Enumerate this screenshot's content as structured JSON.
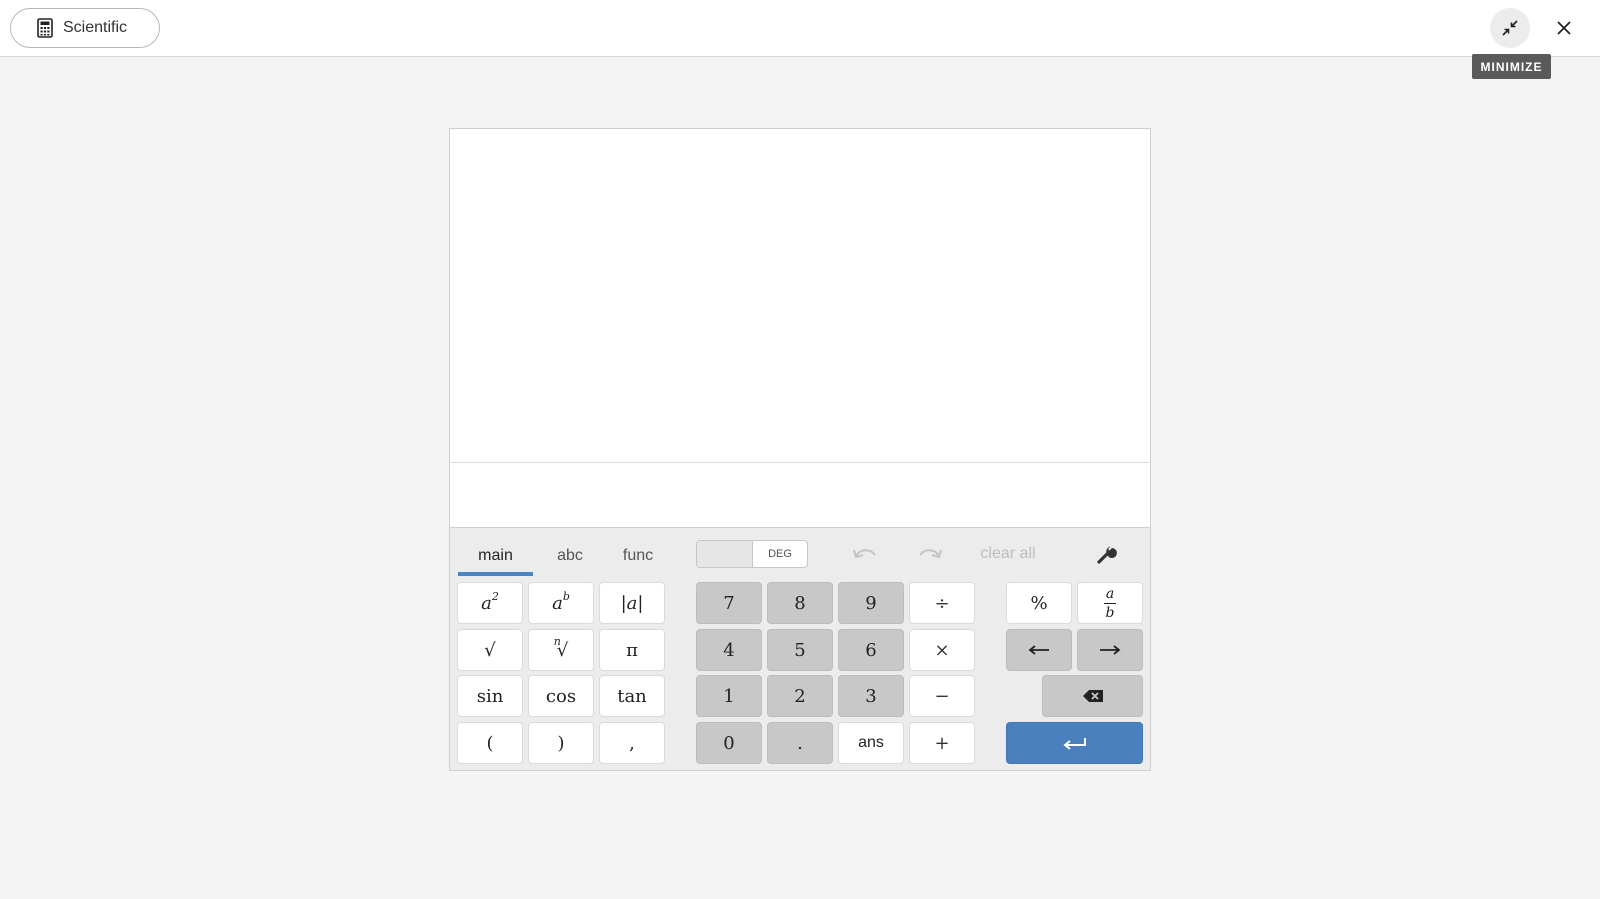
{
  "topbar": {
    "calculator_label": "Scientific",
    "tooltip": "MINIMIZE"
  },
  "keypad": {
    "tabs": [
      {
        "label": "main",
        "active": true
      },
      {
        "label": "abc",
        "active": false
      },
      {
        "label": "func",
        "active": false
      }
    ],
    "angle_mode": "DEG",
    "clear_all": "clear all",
    "functions": [
      [
        "a2",
        "ab",
        "|a|"
      ],
      [
        "√",
        "n√",
        "π"
      ],
      [
        "sin",
        "cos",
        "tan"
      ],
      [
        "(",
        ")",
        ","
      ]
    ],
    "numbers": [
      [
        "7",
        "8",
        "9",
        "÷"
      ],
      [
        "4",
        "5",
        "6",
        "×"
      ],
      [
        "1",
        "2",
        "3",
        "−"
      ],
      [
        "0",
        ".",
        "ans",
        "+"
      ]
    ],
    "extras": {
      "percent": "%",
      "fraction_num": "a",
      "fraction_den": "b",
      "left_arrow": "⟵",
      "right_arrow": "⟶"
    },
    "labels": {
      "abs": "|a|",
      "sqrt": "√",
      "nroot_index": "n",
      "pi": "π",
      "sin": "sin",
      "cos": "cos",
      "tan": "tan",
      "lparen": "(",
      "rparen": ")",
      "comma": ",",
      "seven": "7",
      "eight": "8",
      "nine": "9",
      "divide": "÷",
      "four": "4",
      "five": "5",
      "six": "6",
      "times": "×",
      "one": "1",
      "two": "2",
      "three": "3",
      "minus": "−",
      "zero": "0",
      "dot": ".",
      "ans": "ans",
      "plus": "+",
      "square_base": "a",
      "square_exp": "2",
      "power_base": "a",
      "power_exp": "b"
    }
  },
  "colors": {
    "accent": "#4a80bd",
    "number_key": "#c8c8c8",
    "background": "#f4f4f4"
  },
  "icons": {
    "calculator": "calculator-icon",
    "minimize": "minimize-icon",
    "close": "close-icon",
    "undo": "undo-icon",
    "redo": "redo-icon",
    "settings": "wrench-icon",
    "backspace": "backspace-icon",
    "enter": "enter-icon"
  }
}
